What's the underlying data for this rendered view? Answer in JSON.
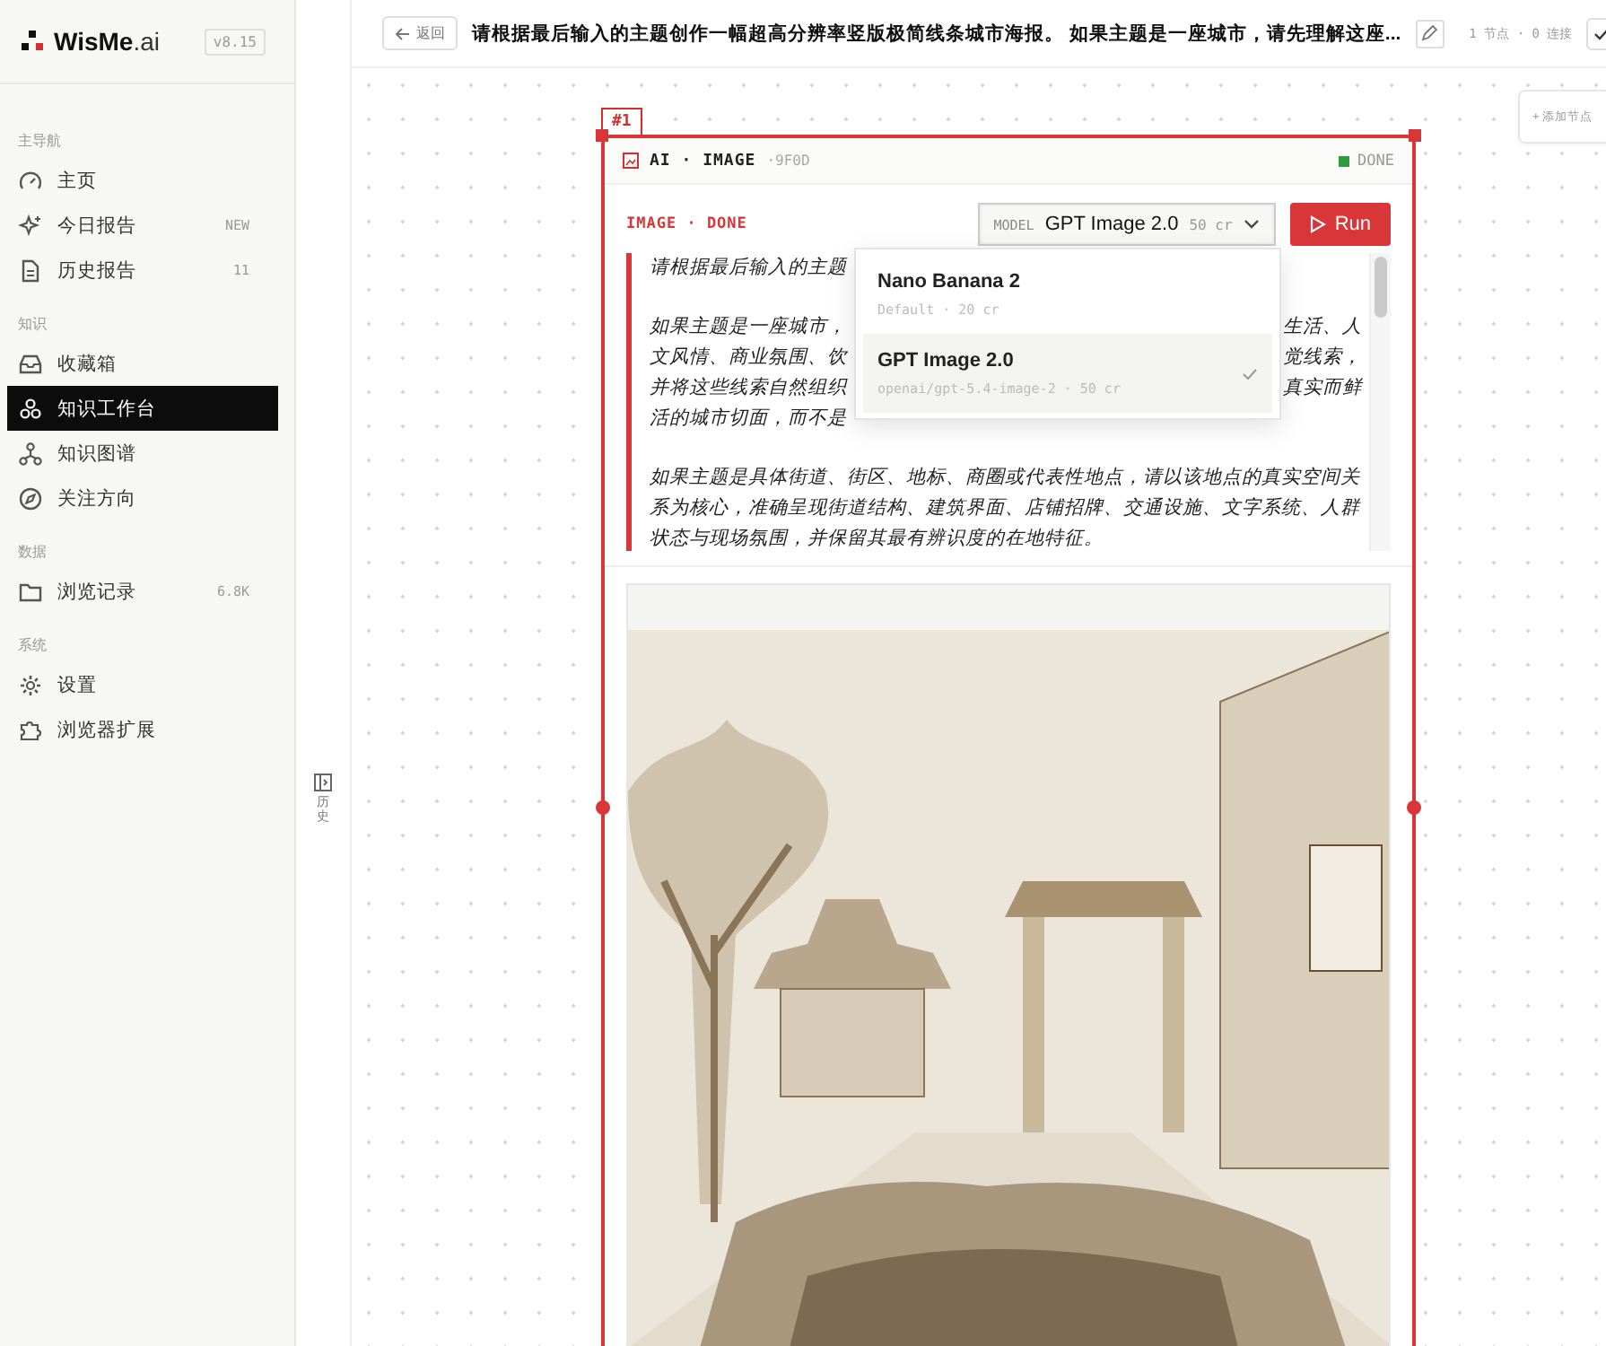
{
  "sidebar": {
    "logo": {
      "name_a": "WisMe",
      "name_b": ".ai"
    },
    "version": "v8.15",
    "sections": [
      {
        "label": "主导航",
        "items": [
          {
            "label": "主页",
            "selected": false
          },
          {
            "label": "今日报告",
            "badge": "NEW",
            "selected": false
          },
          {
            "label": "历史报告",
            "badge": "11",
            "selected": false
          }
        ]
      },
      {
        "label": "知识",
        "items": [
          {
            "label": "收藏箱",
            "selected": false
          },
          {
            "label": "知识工作台",
            "selected": true
          },
          {
            "label": "知识图谱",
            "selected": false
          },
          {
            "label": "关注方向",
            "selected": false
          }
        ]
      },
      {
        "label": "数据",
        "items": [
          {
            "label": "浏览记录",
            "badge": "6.8K",
            "selected": false
          }
        ]
      },
      {
        "label": "系统",
        "items": [
          {
            "label": "设置",
            "selected": false
          },
          {
            "label": "浏览器扩展",
            "selected": false
          }
        ]
      }
    ]
  },
  "history_strip": {
    "label": "历史"
  },
  "top_bar": {
    "back": "返回",
    "title": "请根据最后输入的主题创作一幅超高分辨率竖版极简线条城市海报。 如果主题是一座城市，请先理解这座...",
    "stats": "1 节点 · 0 连接"
  },
  "add_node": "+ 添加节点",
  "node": {
    "tag": "#1",
    "type": "AI · IMAGE",
    "id": "·9F0D",
    "status": {
      "kind": "done",
      "label": "DONE"
    },
    "body_status": "IMAGE · DONE",
    "model": {
      "label": "MODEL",
      "value": "GPT Image 2.0",
      "cost": "50 cr"
    },
    "run": "Run",
    "prompt": [
      [
        {
          "left": "请根据最后输入的主题"
        }
      ],
      [
        {
          "left": "如果主题是一座城市，",
          "right": "生活、人"
        },
        {
          "left": "文风情、商业氛围、饮",
          "right": "觉线索，"
        },
        {
          "left": "并将这些线索自然组织",
          "right": "真实而鲜"
        },
        {
          "left": "活的城市切面，而不是"
        }
      ],
      [
        {
          "left": "如果主题是具体街道、街区、地标、商圈或代表性地点，请以该地点的真实空间关"
        },
        {
          "left": "系为核心，准确呈现街道结构、建筑界面、店铺招牌、交通设施、文字系统、人群"
        },
        {
          "left": "状态与现场氛围，并保留其最有辨识度的在地特征。"
        }
      ]
    ],
    "model_options": [
      {
        "name": "Nano Banana 2",
        "meta": "Default · 20 cr",
        "selected": false
      },
      {
        "name": "GPT Image 2.0",
        "meta": "openai/gpt-5.4-image-2 · 50 cr",
        "selected": true
      }
    ],
    "output": {
      "kind": "picture"
    }
  }
}
